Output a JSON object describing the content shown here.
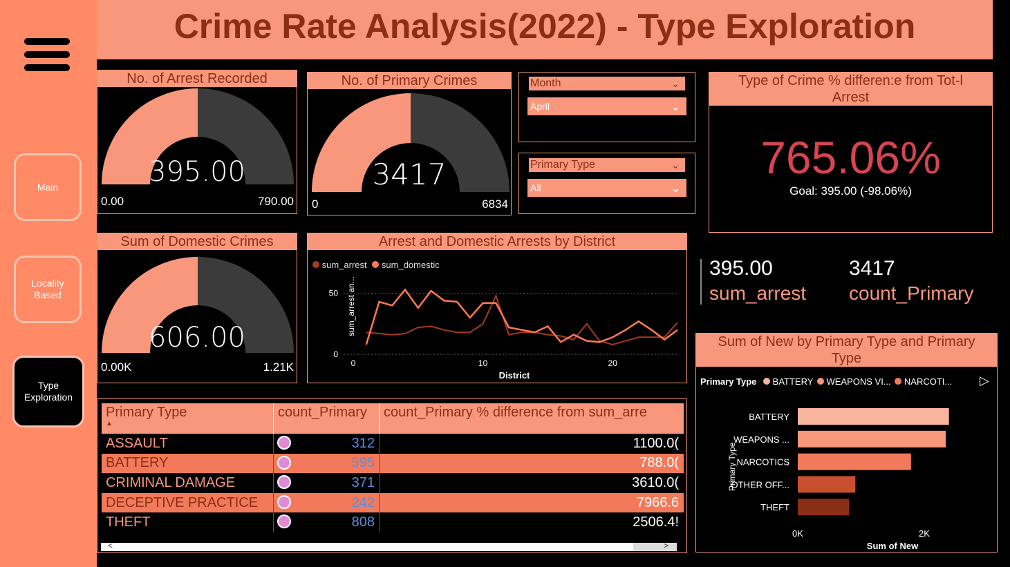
{
  "title": "Crime Rate Analysis(2022) - Type Exploration",
  "nav": {
    "main": "Main",
    "locality": "Locality Based",
    "type": "Type Exploration"
  },
  "gauges": {
    "arrest": {
      "title": "No. of Arrest Recorded",
      "value": "395.00",
      "min": "0.00",
      "max": "790.00",
      "fraction": 0.5
    },
    "primary": {
      "title": "No. of Primary Crimes",
      "value": "3417",
      "min": "0",
      "max": "6834",
      "fraction": 0.5
    },
    "domestic": {
      "title": "Sum of Domestic Crimes",
      "value": "606.00",
      "min": "0.00K",
      "max": "1.21K",
      "fraction": 0.5
    }
  },
  "slicers": {
    "month": {
      "label": "Month",
      "value": "April"
    },
    "ptype": {
      "label": "Primary Type",
      "value": "All"
    }
  },
  "kpi": {
    "title": "Type of Crime % differen:e from Tot-l Arrest",
    "value": "765.06%",
    "goal": "Goal: 395.00 (-98.06%)"
  },
  "cards": {
    "arrest_value": "395.00",
    "arrest_label": "sum_arrest",
    "primary_value": "3417",
    "primary_label": "count_Primary"
  },
  "colors": {
    "accent": "#F9977C",
    "dark_text": "#8B2E16",
    "kpi_red": "#D64550",
    "row_alt": "#F27A5A"
  },
  "line_chart": {
    "title": "Arrest and Domestic Arrests by District",
    "legend": [
      "sum_arrest",
      "sum_domestic"
    ],
    "xlabel": "District",
    "ylabel": "sum_arrest an...",
    "xticks": [
      "0",
      "10",
      "20"
    ],
    "yticks": [
      "0",
      "50"
    ]
  },
  "chart_data": [
    {
      "type": "line",
      "title": "Arrest and Domestic Arrests by District",
      "xlabel": "District",
      "ylabel": "sum_arrest an...",
      "x": [
        1,
        2,
        3,
        4,
        5,
        6,
        7,
        8,
        9,
        10,
        11,
        12,
        13,
        14,
        15,
        16,
        17,
        18,
        19,
        20,
        21,
        22,
        23,
        24,
        25
      ],
      "series": [
        {
          "name": "sum_arrest",
          "color": "#A63A1E",
          "values": [
            18,
            17,
            16,
            17,
            22,
            23,
            20,
            18,
            18,
            25,
            48,
            16,
            18,
            18,
            16,
            15,
            12,
            25,
            11,
            8,
            11,
            14,
            14,
            14,
            26
          ]
        },
        {
          "name": "sum_domestic",
          "color": "#FF7A50",
          "values": [
            8,
            43,
            40,
            53,
            38,
            52,
            44,
            43,
            30,
            42,
            42,
            22,
            20,
            18,
            23,
            10,
            16,
            11,
            10,
            14,
            20,
            27,
            20,
            12,
            20
          ]
        }
      ],
      "xlim": [
        0,
        25
      ],
      "ylim": [
        0,
        60
      ]
    },
    {
      "type": "bar",
      "orientation": "horizontal",
      "title": "Sum of New by Primary Type and Primary Type",
      "legend_title": "Primary Type",
      "legend": [
        "BATTERY",
        "WEAPONS VI...",
        "NARCOTI..."
      ],
      "categories": [
        "BATTERY",
        "WEAPONS ...",
        "NARCOTICS",
        "OTHER OFF...",
        "THEFT"
      ],
      "values": [
        2390,
        2340,
        1790,
        910,
        810
      ],
      "colors": [
        "#F8B49E",
        "#F9977C",
        "#F27A5A",
        "#C9502E",
        "#8B2E16"
      ],
      "xlabel": "Sum of New",
      "ylabel": "Primary Type",
      "xticks": [
        "0K",
        "2K"
      ],
      "xlim": [
        0,
        2000
      ]
    }
  ],
  "table": {
    "headers": [
      "Primary Type",
      "count_Primary",
      "count_Primary % difference from sum_arre"
    ],
    "rows": [
      {
        "type": "ASSAULT",
        "count": "312",
        "pct": "1100.0("
      },
      {
        "type": "BATTERY",
        "count": "595",
        "pct": "788.0("
      },
      {
        "type": "CRIMINAL DAMAGE",
        "count": "371",
        "pct": "3610.0("
      },
      {
        "type": "DECEPTIVE PRACTICE",
        "count": "242",
        "pct": "7966.6"
      },
      {
        "type": "THEFT",
        "count": "808",
        "pct": "2506.4!"
      }
    ]
  }
}
